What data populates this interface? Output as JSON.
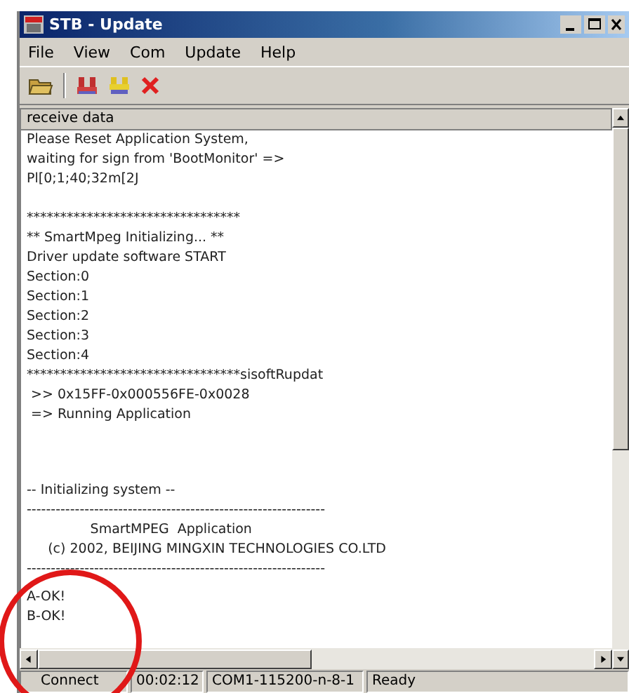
{
  "window": {
    "title": "STB - Update"
  },
  "menu": [
    "File",
    "View",
    "Com",
    "Update",
    "Help"
  ],
  "panel": {
    "title": "receive data"
  },
  "blocks": [
    [
      "Please Reset Application System,",
      "waiting for sign from 'BootMonitor' =>",
      "Pl[0;1;40;32m[2J"
    ],
    [
      "********************************",
      "** SmartMpeg Initializing... **",
      "Driver update software START",
      "Section:0",
      "Section:1",
      "Section:2",
      "Section:3",
      "Section:4",
      "********************************sisoftRupdat",
      " >> 0x15FF-0x000556FE-0x0028",
      " => Running Application"
    ],
    [
      "-- Initializing system --",
      "--------------------------------------------------------------",
      "               SmartMPEG  Application",
      "     (c) 2002, BEIJING MINGXIN TECHNOLOGIES CO.LTD",
      "--------------------------------------------------------------",
      "A-OK!",
      "B-OK!"
    ]
  ],
  "status_bar": [
    "Connect",
    "00:02:12",
    "COM1-115200-n-8-1",
    "Ready"
  ]
}
